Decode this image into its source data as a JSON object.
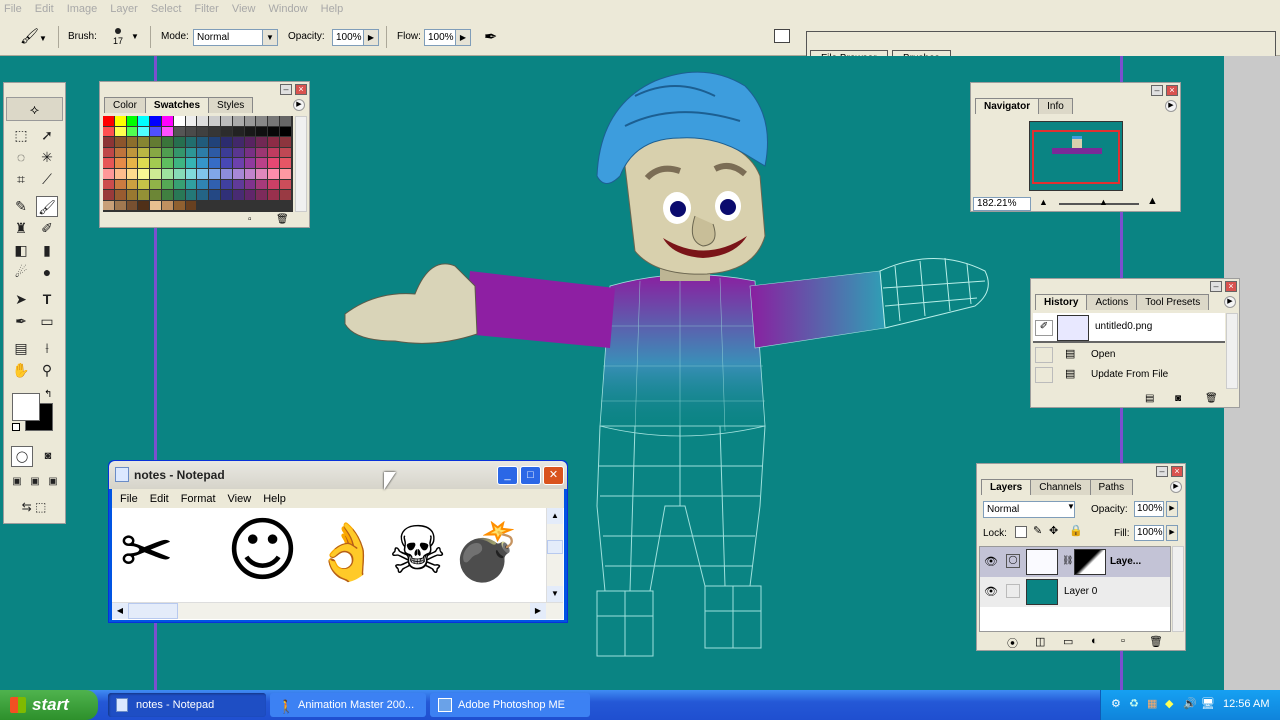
{
  "menubar": {
    "items": [
      "File",
      "Edit",
      "Image",
      "Layer",
      "Select",
      "Filter",
      "View",
      "Window",
      "Help"
    ]
  },
  "options": {
    "brush_label": "Brush:",
    "brush_size": "17",
    "mode_label": "Mode:",
    "mode_value": "Normal",
    "opacity_label": "Opacity:",
    "opacity_value": "100%",
    "flow_label": "Flow:",
    "flow_value": "100%",
    "file_browser_tab": "File Browser",
    "brushes_tab": "Brushes"
  },
  "swatches": {
    "tabs": [
      "Color",
      "Swatches",
      "Styles"
    ],
    "row1": [
      "#ff0000",
      "#ffff00",
      "#00ff00",
      "#00ffff",
      "#0000ff",
      "#ff00ff",
      "#ffffff",
      "#eeeeee",
      "#dddddd",
      "#cccccc",
      "#bbbbbb",
      "#aaaaaa",
      "#999999",
      "#888888",
      "#777777",
      "#666666"
    ],
    "row2": [
      "#ff5050",
      "#ffff50",
      "#50ff50",
      "#50ffff",
      "#5050ff",
      "#ff50ff",
      "#555555",
      "#4a4a4a",
      "#404040",
      "#363636",
      "#2c2c2c",
      "#222222",
      "#181818",
      "#101010",
      "#080808",
      "#000000"
    ],
    "gradient_cols": [
      "#ff6060",
      "#ff9a50",
      "#ffc850",
      "#f6f25a",
      "#b4e05a",
      "#6ad36a",
      "#45c890",
      "#3cc8c8",
      "#3ca6e0",
      "#3c78dc",
      "#5050c8",
      "#7848c0",
      "#a040b0",
      "#d04898",
      "#ff5080",
      "#ff6070"
    ],
    "bottom_row": [
      "#c8a078",
      "#a07850",
      "#785030",
      "#503018",
      "#e8c090",
      "#c09060",
      "#906030",
      "#684020"
    ]
  },
  "navigator": {
    "tabs": [
      "Navigator",
      "Info"
    ],
    "zoom": "182.21%"
  },
  "history": {
    "tabs": [
      "History",
      "Actions",
      "Tool Presets"
    ],
    "snapshot": "untitled0.png",
    "states": [
      "Open",
      "Update From File"
    ]
  },
  "layers": {
    "tabs": [
      "Layers",
      "Channels",
      "Paths"
    ],
    "blend_mode": "Normal",
    "opacity_label": "Opacity:",
    "opacity_value": "100%",
    "lock_label": "Lock:",
    "fill_label": "Fill:",
    "fill_value": "100%",
    "rows": [
      "Laye...",
      "Layer 0"
    ]
  },
  "notepad": {
    "title": "notes - Notepad",
    "menu": [
      "File",
      "Edit",
      "Format",
      "View",
      "Help"
    ],
    "symbols": [
      "✂",
      "☺",
      "👌",
      "☠",
      "💣"
    ]
  },
  "taskbar": {
    "start_label": "start",
    "tasks": [
      "notes - Notepad",
      "Animation Master 200...",
      "Adobe Photoshop ME"
    ],
    "clock": "12:56 AM"
  },
  "colors": {
    "workspace": "#0a8483",
    "guide_lines": "#7b4fcf",
    "xp_blue": "#2458d6",
    "start_green": "#3a9d38"
  }
}
